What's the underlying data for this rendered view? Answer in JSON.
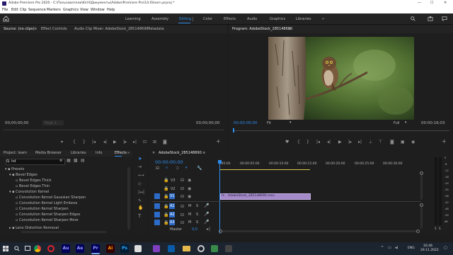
{
  "title": "Adobe Premiere Pro 2020 - C:\\Пользователи\\Kirill\\Документы\\Adobe\\Premiere Pro\\14.0\\learn.prproj *",
  "window_controls": [
    "—",
    "☐",
    "✕"
  ],
  "menu": [
    "File",
    "Edit",
    "Clip",
    "Sequence",
    "Markers",
    "Graphics",
    "View",
    "Window",
    "Help"
  ],
  "workspaces": {
    "home_icon": "home-icon",
    "items": [
      "Learning",
      "Assembly",
      "Editing",
      "Color",
      "Effects",
      "Audio",
      "Graphics",
      "Libraries"
    ],
    "active": "Editing",
    "more": "»"
  },
  "source_panel": {
    "tabs": [
      "Source: (no clips)",
      "Effect Controls",
      "Audio Clip Mixer: AdobeStock_285148690",
      "Metadata"
    ],
    "menu": "≡",
    "timecode_left": "00;00;00;00",
    "timecode_right": "00;00;00;00",
    "page": "Page 1"
  },
  "program_panel": {
    "title": "Program: AdobeStock_285148690",
    "menu": "≡",
    "timecode_left": "00:00:00:00",
    "fit": "Fit",
    "full": "Full",
    "timecode_right": "00:00:16:03"
  },
  "project_panel": {
    "tabs": [
      "Project: learn",
      "Media Browser",
      "Libraries",
      "Info",
      "Effects"
    ],
    "more": "»",
    "search_value": "hd",
    "tree": [
      {
        "label": "Presets",
        "level": 0
      },
      {
        "label": "Bevel Edges",
        "level": 1
      },
      {
        "label": "Bevel Edges Thick",
        "level": 2
      },
      {
        "label": "Bevel Edges Thin",
        "level": 2
      },
      {
        "label": "Convolution Kernel",
        "level": 1
      },
      {
        "label": "Convolution Kernel Gaussian Sharpen",
        "level": 2
      },
      {
        "label": "Convolution Kernel Light Emboss",
        "level": 2
      },
      {
        "label": "Convolution Kernel Sharpen",
        "level": 2
      },
      {
        "label": "Convolution Kernel Sharpen Edges",
        "level": 2
      },
      {
        "label": "Convolution Kernel Sharpen More",
        "level": 2
      },
      {
        "label": "Lens Distortion Removal",
        "level": 1
      }
    ]
  },
  "timeline": {
    "sequence": "AdobeStock_285148690",
    "menu": "≡",
    "timecode": "00:00:00:00",
    "ruler": [
      ":00:00",
      "00:00:05:00",
      "00:00:10:00",
      "00:00:15:00",
      "00:00:20:00",
      "00:00:25:00",
      "00:00:30:00"
    ],
    "tracks": [
      "V3",
      "V2",
      "V1",
      "A1",
      "A2",
      "A3"
    ],
    "track_letters": [
      "M",
      "S"
    ],
    "master": "Master",
    "master_value": "0,0",
    "clip_name": "AdobeStock_285148690.mov"
  },
  "meter_labels": [
    "0",
    "-6",
    "-12",
    "-18",
    "-24",
    "-30",
    "-36",
    "-42",
    "-48",
    "-54",
    "dB"
  ],
  "meter_footer": [
    "S",
    "S"
  ],
  "taskbar": {
    "apps": [
      {
        "name": "Au",
        "color": "#00005b",
        "text": "Au"
      },
      {
        "name": "Ae",
        "color": "#00005b",
        "text": "Ae"
      },
      {
        "name": "Pr",
        "color": "#00005b",
        "text": "Pr"
      },
      {
        "name": "Ai",
        "color": "#330000",
        "text": "Ai"
      },
      {
        "name": "Ps",
        "color": "#001e36",
        "text": "Ps"
      }
    ],
    "lang": "ENG",
    "time": "16:46",
    "date": "29.11.2022"
  }
}
